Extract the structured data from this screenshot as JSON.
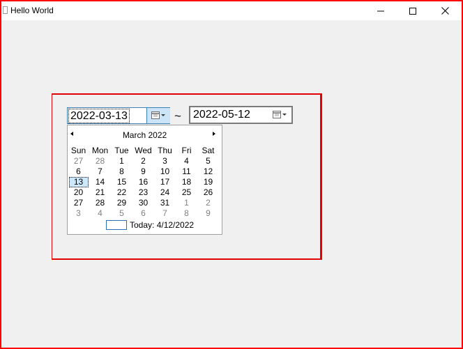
{
  "window": {
    "title": "Hello World",
    "minimize_icon": "minimize-icon",
    "maximize_icon": "maximize-icon",
    "close_icon": "close-icon"
  },
  "date_range": {
    "start": {
      "value": "2022-03-13",
      "button_icon": "calendar-dropdown-icon"
    },
    "separator": "~",
    "end": {
      "value": "2022-05-12",
      "button_icon": "calendar-dropdown-icon"
    }
  },
  "calendar": {
    "month_label": "March 2022",
    "prev_icon": "triangle-left-icon",
    "next_icon": "triangle-right-icon",
    "weekdays": [
      "Sun",
      "Mon",
      "Tue",
      "Wed",
      "Thu",
      "Fri",
      "Sat"
    ],
    "weeks": [
      [
        "27",
        "28",
        "1",
        "2",
        "3",
        "4",
        "5"
      ],
      [
        "6",
        "7",
        "8",
        "9",
        "10",
        "11",
        "12"
      ],
      [
        "13",
        "14",
        "15",
        "16",
        "17",
        "18",
        "19"
      ],
      [
        "20",
        "21",
        "22",
        "23",
        "24",
        "25",
        "26"
      ],
      [
        "27",
        "28",
        "29",
        "30",
        "31",
        "1",
        "2"
      ],
      [
        "3",
        "4",
        "5",
        "6",
        "7",
        "8",
        "9"
      ]
    ],
    "selected_day": "13",
    "today_label": "Today: 4/12/2022"
  },
  "colors": {
    "frame_border": "#ff0000",
    "selection_bg": "#cce8ff",
    "button_hover": "#cce4f7"
  }
}
